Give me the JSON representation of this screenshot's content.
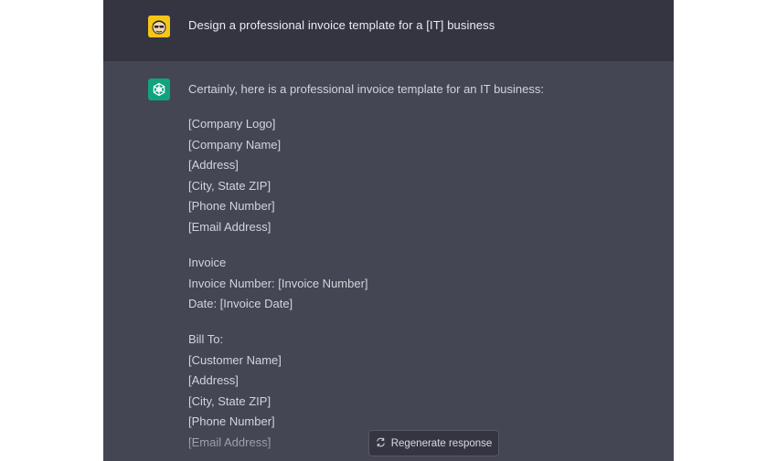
{
  "user_message": {
    "avatar_icon": "user-avatar-icon",
    "text": "Design a professional invoice template for a [IT] business"
  },
  "assistant_message": {
    "avatar_icon": "openai-logo-icon",
    "intro": "Certainly, here is a professional invoice template for an IT business:",
    "company_block": [
      "[Company Logo]",
      "[Company Name]",
      "[Address]",
      "[City, State ZIP]",
      "[Phone Number]",
      "[Email Address]"
    ],
    "invoice_block": [
      "Invoice",
      "Invoice Number: [Invoice Number]",
      "Date: [Invoice Date]"
    ],
    "bill_block": [
      "Bill To:",
      "[Customer Name]",
      "[Address]",
      "[City, State ZIP]",
      "[Phone Number]",
      "[Email Address]"
    ]
  },
  "regenerate_button": {
    "icon": "refresh-icon",
    "label": "Regenerate response"
  },
  "colors": {
    "user_row_bg": "#343541",
    "assistant_row_bg": "#444654",
    "bot_avatar": "#10a37f",
    "user_avatar": "#f5c518"
  }
}
